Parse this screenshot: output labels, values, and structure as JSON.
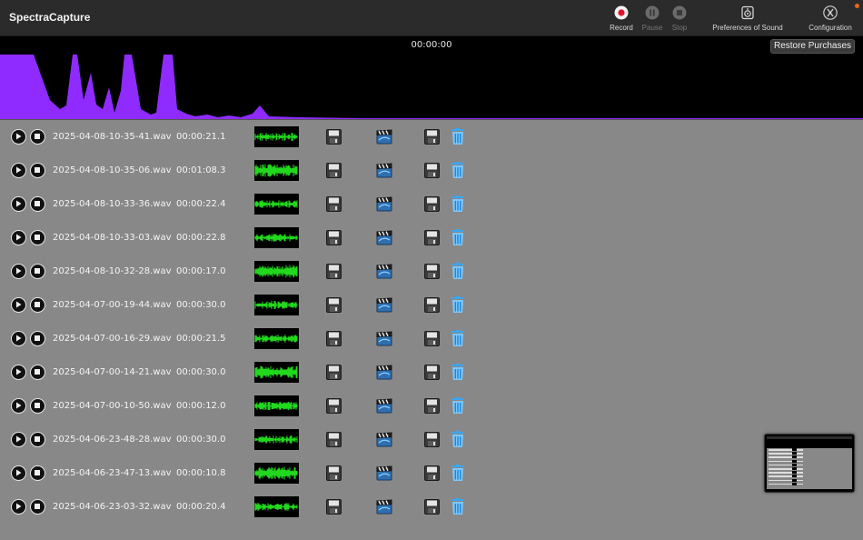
{
  "app": {
    "title": "SpectraCapture"
  },
  "toolbar": {
    "record": {
      "label": "Record",
      "icon": "record-icon",
      "enabled": true
    },
    "pause": {
      "label": "Pause",
      "icon": "pause-icon",
      "enabled": false
    },
    "stop": {
      "label": "Stop",
      "icon": "stop-icon",
      "enabled": false
    },
    "preferences": {
      "label": "Preferences of Sound",
      "icon": "speaker-icon"
    },
    "configuration": {
      "label": "Configuration",
      "icon": "settings-icon"
    }
  },
  "waveform": {
    "timer": "00:00:00",
    "restore_label": "Restore Purchases",
    "color": "#8f2bff"
  },
  "recordings": [
    {
      "name": "2025-04-08-10-35-41.wav",
      "duration": "00:00:21.1"
    },
    {
      "name": "2025-04-08-10-35-06.wav",
      "duration": "00:01:08.3"
    },
    {
      "name": "2025-04-08-10-33-36.wav",
      "duration": "00:00:22.4"
    },
    {
      "name": "2025-04-08-10-33-03.wav",
      "duration": "00:00:22.8"
    },
    {
      "name": "2025-04-08-10-32-28.wav",
      "duration": "00:00:17.0"
    },
    {
      "name": "2025-04-07-00-19-44.wav",
      "duration": "00:00:30.0"
    },
    {
      "name": "2025-04-07-00-16-29.wav",
      "duration": "00:00:21.5"
    },
    {
      "name": "2025-04-07-00-14-21.wav",
      "duration": "00:00:30.0"
    },
    {
      "name": "2025-04-07-00-10-50.wav",
      "duration": "00:00:12.0"
    },
    {
      "name": "2025-04-06-23-48-28.wav",
      "duration": "00:00:30.0"
    },
    {
      "name": "2025-04-06-23-47-13.wav",
      "duration": "00:00:10.8"
    },
    {
      "name": "2025-04-06-23-03-32.wav",
      "duration": "00:00:20.4"
    }
  ],
  "colors": {
    "accent_wave": "#8f2bff",
    "thumb_wave": "#22d81e",
    "record_red": "#e0142a",
    "trash_blue": "#3aa6f0"
  }
}
